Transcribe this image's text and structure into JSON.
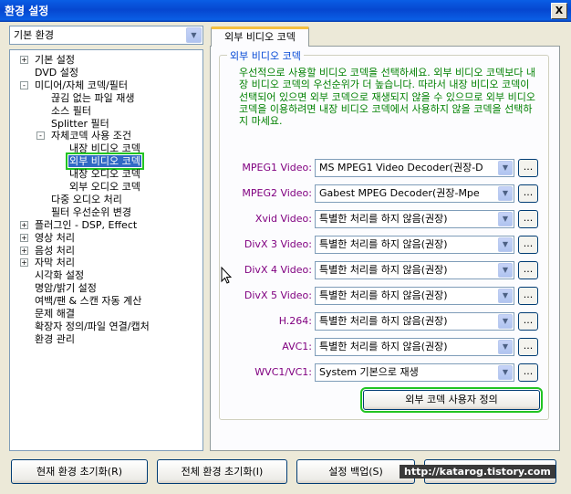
{
  "window": {
    "title": "환경 설정",
    "close": "X"
  },
  "left": {
    "combo_value": "기본 환경",
    "tree": [
      {
        "label": "기본 설정",
        "expander": "+"
      },
      {
        "label": "DVD 설정",
        "expander": ""
      },
      {
        "label": "미디어/자체 코덱/필터",
        "expander": "-"
      },
      {
        "label": "끊김 없는 파일 재생",
        "expander": ""
      },
      {
        "label": "소스 필터",
        "expander": ""
      },
      {
        "label": "Splitter 필터",
        "expander": ""
      },
      {
        "label": "자체코덱 사용 조건",
        "expander": "-"
      },
      {
        "label": "내장 비디오 코덱",
        "expander": ""
      },
      {
        "label": "외부 비디오 코덱",
        "expander": ""
      },
      {
        "label": "내장 오디오 코덱",
        "expander": ""
      },
      {
        "label": "외부 오디오 코덱",
        "expander": ""
      },
      {
        "label": "다중 오디오 처리",
        "expander": ""
      },
      {
        "label": "필터 우선순위 변경",
        "expander": ""
      },
      {
        "label": "플러그인 - DSP, Effect",
        "expander": "+"
      },
      {
        "label": "영상 처리",
        "expander": "+"
      },
      {
        "label": "음성 처리",
        "expander": "+"
      },
      {
        "label": "자막 처리",
        "expander": "+"
      },
      {
        "label": "시각화 설정",
        "expander": ""
      },
      {
        "label": "명암/밝기 설정",
        "expander": ""
      },
      {
        "label": "여백/팬 & 스캔 자동 계산",
        "expander": ""
      },
      {
        "label": "문제 해결",
        "expander": ""
      },
      {
        "label": "확장자 정의/파일 연결/캡처",
        "expander": ""
      },
      {
        "label": "환경 관리",
        "expander": ""
      }
    ]
  },
  "right": {
    "tab_label": "외부 비디오 코덱",
    "group_title": "외부 비디오 코덱",
    "description": "우선적으로 사용할 비디오 코덱을 선택하세요. 외부 비디오 코덱보다 내장 비디오 코덱의 우선순위가 더 높습니다. 따라서 내장 비디오 코덱이 선택되어 있으면 외부 코덱으로 재생되지 않을 수 있으므로 외부 비디오 코덱을 이용하려면 내장 비디오 코덱에서 사용하지 않을 코덱을 선택하지 마세요.",
    "codecs": [
      {
        "label": "MPEG1 Video:",
        "value": "MS MPEG1 Video Decoder(권장-D",
        "label_color": "#800080"
      },
      {
        "label": "MPEG2 Video:",
        "value": "Gabest MPEG Decoder(권장-Mpe",
        "label_color": "#800080"
      },
      {
        "label": "Xvid Video:",
        "value": "특별한 처리를 하지 않음(권장)",
        "label_color": "#800080"
      },
      {
        "label": "DivX 3 Video:",
        "value": "특별한 처리를 하지 않음(권장)",
        "label_color": "#800080"
      },
      {
        "label": "DivX 4 Video:",
        "value": "특별한 처리를 하지 않음(권장)",
        "label_color": "#800080"
      },
      {
        "label": "DivX 5 Video:",
        "value": "특별한 처리를 하지 않음(권장)",
        "label_color": "#800080"
      },
      {
        "label": "H.264:",
        "value": "특별한 처리를 하지 않음(권장)",
        "label_color": "#800080"
      },
      {
        "label": "AVC1:",
        "value": "특별한 처리를 하지 않음(권장)",
        "label_color": "#800080"
      },
      {
        "label": "WVC1/VC1:",
        "value": "System 기본으로 재생",
        "label_color": "#800080"
      }
    ],
    "dots_label": "...",
    "custom_button": "외부 코덱 사용자 정의"
  },
  "bottom": {
    "reset_current": "현재 환경 초기화(R)",
    "reset_all": "전체 환경 초기화(I)",
    "backup": "설정 백업(S)",
    "close": "닫기(C)"
  },
  "watermark": "http://katarog.tistory.com"
}
